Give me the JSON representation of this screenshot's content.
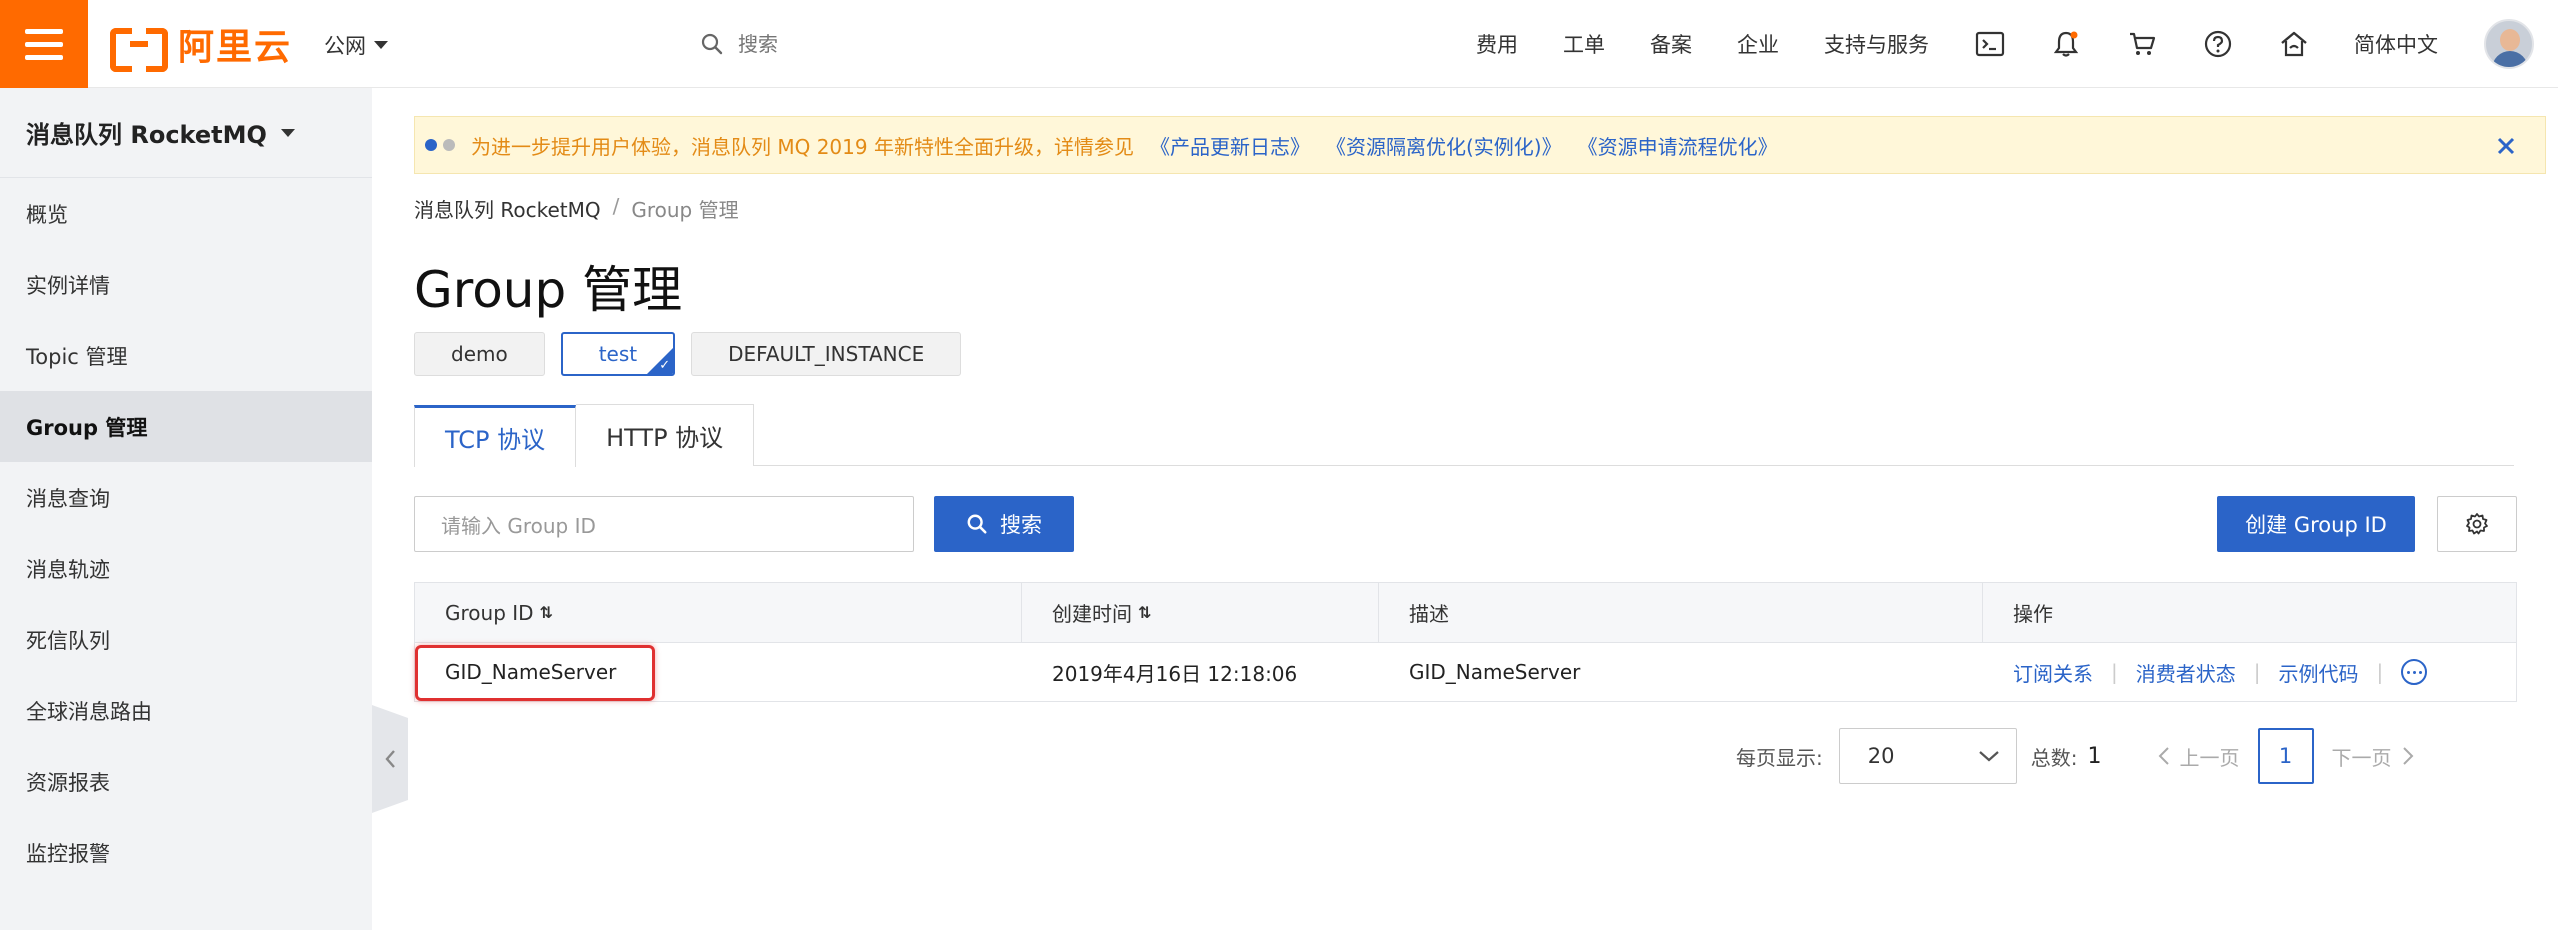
{
  "header": {
    "brand": "阿里云",
    "region": "公网",
    "search_placeholder": "搜索",
    "links": [
      "费用",
      "工单",
      "备案",
      "企业",
      "支持与服务"
    ],
    "language": "简体中文",
    "icons": [
      "terminal-icon",
      "bell-icon",
      "cart-icon",
      "help-icon",
      "home-icon"
    ],
    "notification_dot_color": "#ff6a00"
  },
  "sidebar": {
    "title": "消息队列 RocketMQ",
    "items": [
      {
        "label": "概览"
      },
      {
        "label": "实例详情"
      },
      {
        "label": "Topic 管理"
      },
      {
        "label": "Group 管理",
        "active": true
      },
      {
        "label": "消息查询"
      },
      {
        "label": "消息轨迹"
      },
      {
        "label": "死信队列"
      },
      {
        "label": "全球消息路由"
      },
      {
        "label": "资源报表"
      },
      {
        "label": "监控报警"
      }
    ]
  },
  "notice": {
    "text": "为进一步提升用户体验，消息队列 MQ 2019 年新特性全面升级，详情参见",
    "links": [
      "《产品更新日志》",
      "《资源隔离优化(实例化)》",
      "《资源申请流程优化》"
    ]
  },
  "breadcrumb": {
    "parent": "消息队列 RocketMQ",
    "separator": "/",
    "current": "Group 管理"
  },
  "page": {
    "title": "Group 管理"
  },
  "instances": [
    {
      "label": "demo",
      "selected": false
    },
    {
      "label": "test",
      "selected": true
    },
    {
      "label": "DEFAULT_INSTANCE",
      "selected": false
    }
  ],
  "tabs": [
    {
      "label": "TCP 协议",
      "active": true
    },
    {
      "label": "HTTP 协议",
      "active": false
    }
  ],
  "toolbar": {
    "input_placeholder": "请输入 Group ID",
    "search_label": "搜索",
    "create_label": "创建 Group ID"
  },
  "table": {
    "columns": [
      "Group ID",
      "创建时间",
      "描述",
      "操作"
    ],
    "rows": [
      {
        "group_id": "GID_NameServer",
        "created": "2019年4月16日 12:18:06",
        "description": "GID_NameServer",
        "actions": [
          "订阅关系",
          "消费者状态",
          "示例代码"
        ]
      }
    ]
  },
  "pagination": {
    "page_size_label": "每页显示:",
    "page_size": "20",
    "total_label": "总数:",
    "total": "1",
    "prev_label": "上一页",
    "next_label": "下一页",
    "current_page": "1"
  },
  "colors": {
    "brand_orange": "#ff6a00",
    "primary_blue": "#2b64c8",
    "highlight_red": "#e03030",
    "notice_bg": "#fff7d9"
  }
}
